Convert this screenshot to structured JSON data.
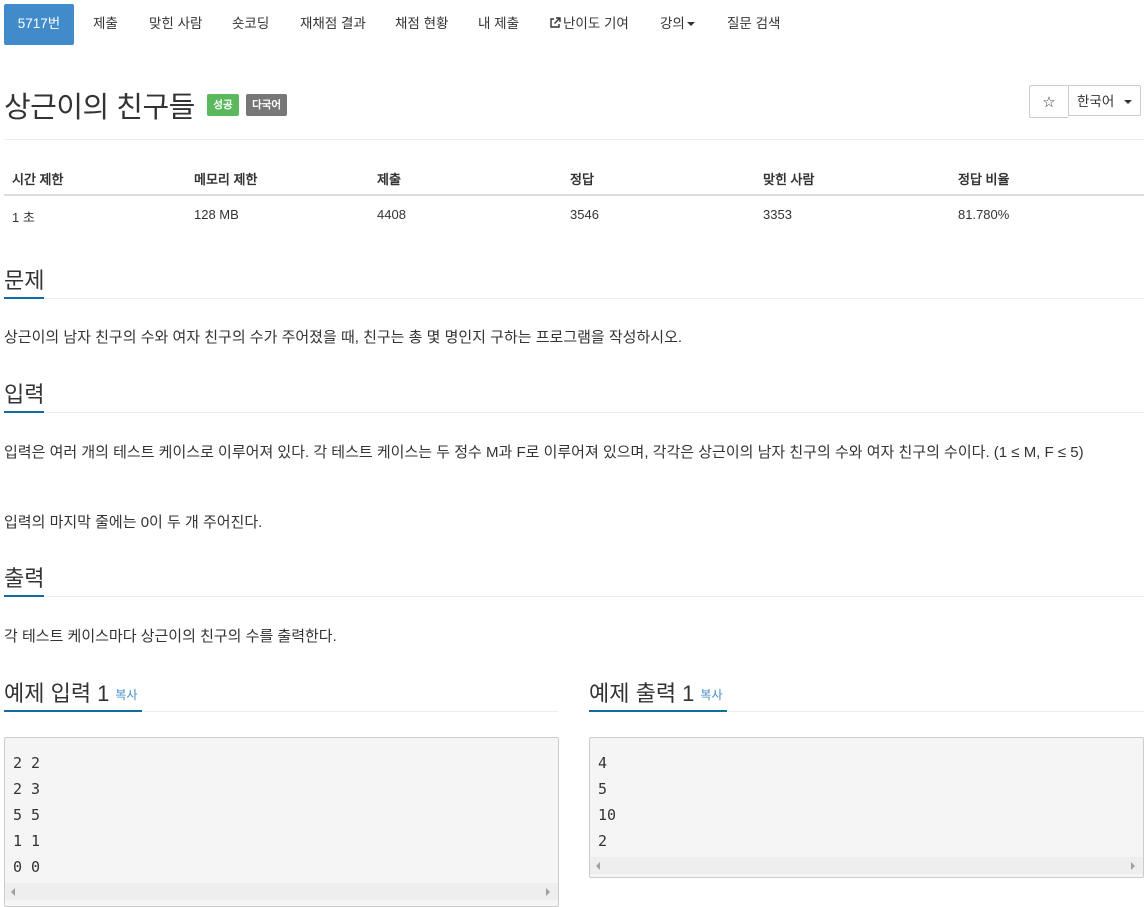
{
  "nav": {
    "tabs": [
      {
        "label": "5717번"
      },
      {
        "label": "제출"
      },
      {
        "label": "맞힌 사람"
      },
      {
        "label": "숏코딩"
      },
      {
        "label": "재채점 결과"
      },
      {
        "label": "채점 현황"
      },
      {
        "label": "내 제출"
      },
      {
        "label": "난이도 기여",
        "icon": "external-link-icon"
      },
      {
        "label": "강의",
        "icon": "caret-down-icon"
      },
      {
        "label": "질문 검색"
      }
    ]
  },
  "problem": {
    "title": "상근이의 친구들",
    "badges": {
      "success": "성공",
      "multilang": "다국어"
    }
  },
  "controls": {
    "star_icon": "star-icon",
    "star_glyph": "☆",
    "language": "한국어"
  },
  "info_table": {
    "headers": [
      "시간 제한",
      "메모리 제한",
      "제출",
      "정답",
      "맞힌 사람",
      "정답 비율"
    ],
    "values": [
      "1 초",
      "128 MB",
      "4408",
      "3546",
      "3353",
      "81.780%"
    ]
  },
  "sections": {
    "problem": {
      "title": "문제",
      "text": "상근이의 남자 친구의 수와 여자 친구의 수가 주어졌을 때, 친구는 총 몇 명인지 구하는 프로그램을 작성하시오."
    },
    "input": {
      "title": "입력",
      "text1": "입력은 여러 개의 테스트 케이스로 이루어져 있다. 각 테스트 케이스는 두 정수 M과 F로 이루어져 있으며, 각각은 상근이의 남자 친구의 수와 여자 친구의 수이다. (1 ≤ M, F ≤ 5)",
      "text2": "입력의 마지막 줄에는 0이 두 개 주어진다."
    },
    "output": {
      "title": "출력",
      "text": "각 테스트 케이스마다 상근이의 친구의 수를 출력한다."
    }
  },
  "samples": {
    "input": {
      "title": "예제 입력 1",
      "copy": "복사",
      "lines": [
        "2 2",
        "2 3",
        "5 5",
        "1 1",
        "0 0"
      ]
    },
    "output": {
      "title": "예제 출력 1",
      "copy": "복사",
      "lines": [
        "4",
        "5",
        "10",
        "2"
      ]
    }
  },
  "colors": {
    "accent": "#428bca",
    "success": "#5cb85c",
    "badge_gray": "#777777",
    "underline": "#0f6ea0"
  }
}
